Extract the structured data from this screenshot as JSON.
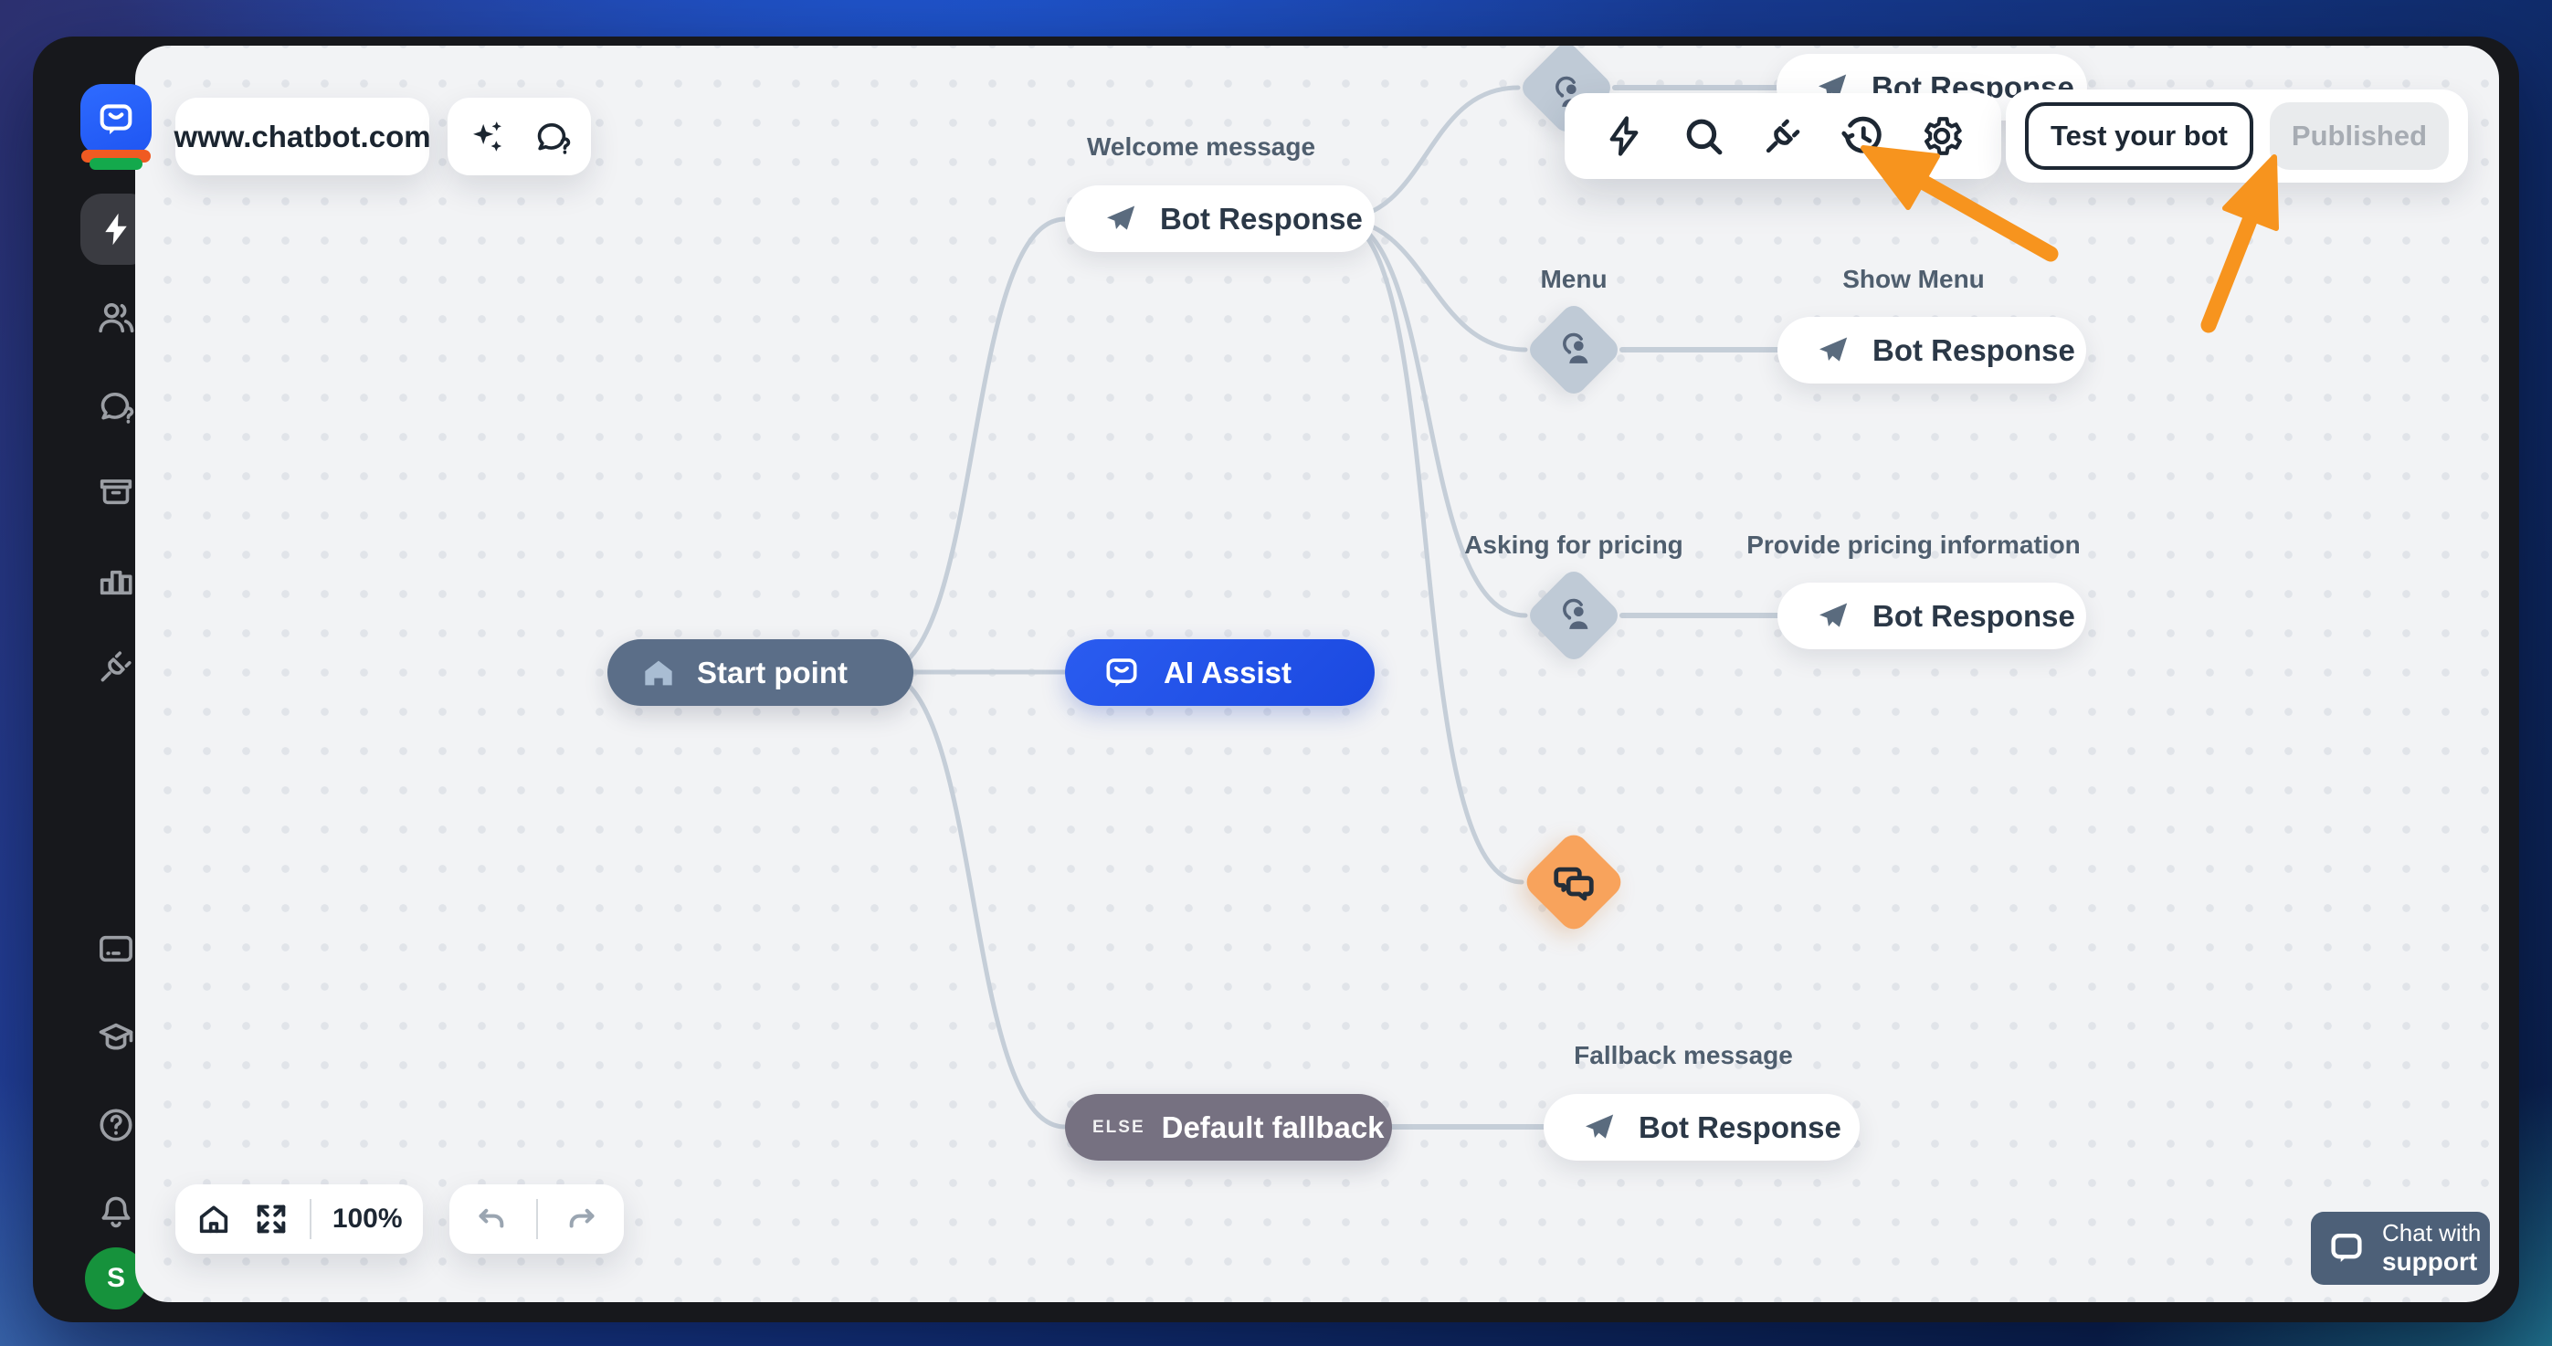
{
  "sidebar": {
    "avatar_initial": "S",
    "items": [
      "chatbot-logo",
      "automation-lightning",
      "audience-people",
      "chats",
      "archive",
      "reports-chart",
      "integrations-plug",
      "billing-card",
      "academy-cap",
      "help-question",
      "notifications-bell",
      "user-avatar"
    ]
  },
  "topbar": {
    "url": "www.chatbot.com",
    "tools": [
      "ai-sparkles",
      "chat-question"
    ]
  },
  "toolbar": {
    "icons": [
      "lightning",
      "search",
      "plug",
      "history",
      "settings-gear"
    ]
  },
  "header_buttons": {
    "test": "Test your bot",
    "published": "Published"
  },
  "flow": {
    "bot_response_label": "Bot Response",
    "start": {
      "label": "Start point"
    },
    "ai_assist": {
      "label": "AI Assist"
    },
    "welcome": {
      "label": "Welcome message"
    },
    "menu": {
      "label": "Menu",
      "target_label": "Show Menu"
    },
    "pricing": {
      "label": "Asking for pricing",
      "target_label": "Provide pricing information"
    },
    "fallback": {
      "tag": "ELSE",
      "label": "Default fallback",
      "target_label": "Fallback message"
    }
  },
  "canvas_controls": {
    "zoom_level": "100%"
  },
  "support": {
    "line1": "Chat with",
    "line2": "support"
  },
  "colors": {
    "accent_blue": "#2056ea",
    "node_slate": "#5b6e88",
    "fallback_gray": "#767181",
    "diamond_gray": "#bfcad6",
    "diamond_orange": "#f8a35c",
    "arrow_orange": "#f7941e",
    "connector": "#c5ced8",
    "avatar_green": "#16923c",
    "support_slate": "#4d6078"
  }
}
